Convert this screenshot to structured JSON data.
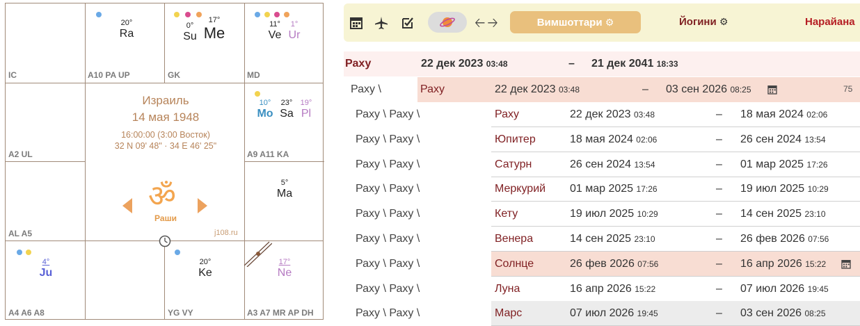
{
  "chart": {
    "center": {
      "place": "Израиль",
      "date": "14 мая 1948",
      "time": "16:00:00 (3:00 Восток)",
      "coords": "32 N 09' 48\" · 34 E 46' 25\"",
      "rashi_label": "Раши",
      "site": "j108.ru",
      "om_symbol": "ॐ"
    },
    "houses": {
      "ic": "IC",
      "a10": "A10 PA UP",
      "gk": "GK",
      "md": "MD",
      "a2": "A2 UL",
      "a9": "A9 A11 KA",
      "al": "AL A5",
      "a4": "A4 A6 A8",
      "yg": "YG VY",
      "a3": "A3 A7 MR AP DH"
    },
    "planets": {
      "ra": {
        "deg": "20°",
        "name": "Ra"
      },
      "su": {
        "deg": "0°",
        "name": "Su"
      },
      "me": {
        "deg": "17°",
        "name": "Me"
      },
      "ve": {
        "deg": "11°",
        "name": "Ve"
      },
      "ur": {
        "deg": "1°",
        "name": "Ur"
      },
      "mo": {
        "deg": "10°",
        "name": "Mo"
      },
      "sa": {
        "deg": "23°",
        "name": "Sa"
      },
      "pl": {
        "deg": "19°",
        "name": "Pl"
      },
      "ma": {
        "deg": "5°",
        "name": "Ma"
      },
      "ju": {
        "deg": "4°",
        "name": "Ju"
      },
      "ke": {
        "deg": "20°",
        "name": "Ke"
      },
      "ne": {
        "deg": "17°",
        "name": "Ne"
      }
    },
    "colors": {
      "blue_dot": "#6aa9e6",
      "yellow_dot": "#f2d34f",
      "pink_dot": "#d94c8f",
      "orange_dot": "#f0a35b",
      "mo": "#3a8fc1",
      "ur_pl_ne": "#b57ac2",
      "ju": "#5960d6",
      "accent": "#b7845a"
    }
  },
  "toolbar": {
    "icons": [
      "calendar-icon",
      "airplane-icon",
      "edit-check-icon",
      "planet-icon",
      "arrow-left-icon",
      "arrow-right-icon",
      "gear-icon"
    ],
    "vimshottari": "Вимшоттари",
    "yogini": "Йогини",
    "narayana": "Нарайана"
  },
  "dasha": {
    "maha": {
      "lord": "Раху",
      "start_date": "22 дек 2023",
      "start_time": "03:48",
      "dash": "–",
      "end_date": "21 дек 2041",
      "end_time": "18:33"
    },
    "antar": {
      "path": "Раху \\",
      "lord": "Раху",
      "start_date": "22 дек 2023",
      "start_time": "03:48",
      "dash": "–",
      "end_date": "03 сен 2026",
      "end_time": "08:25",
      "count": "75"
    },
    "pratyantar": [
      {
        "path": "Раху \\ Раху \\",
        "lord": "Раху",
        "start_date": "22 дек 2023",
        "start_time": "03:48",
        "dash": "–",
        "end_date": "18 мая 2024",
        "end_time": "02:06"
      },
      {
        "path": "Раху \\ Раху \\",
        "lord": "Юпитер",
        "start_date": "18 мая 2024",
        "start_time": "02:06",
        "dash": "–",
        "end_date": "26 сен 2024",
        "end_time": "13:54"
      },
      {
        "path": "Раху \\ Раху \\",
        "lord": "Сатурн",
        "start_date": "26 сен 2024",
        "start_time": "13:54",
        "dash": "–",
        "end_date": "01 мар 2025",
        "end_time": "17:26"
      },
      {
        "path": "Раху \\ Раху \\",
        "lord": "Меркурий",
        "start_date": "01 мар 2025",
        "start_time": "17:26",
        "dash": "–",
        "end_date": "19 июл 2025",
        "end_time": "10:29"
      },
      {
        "path": "Раху \\ Раху \\",
        "lord": "Кету",
        "start_date": "19 июл 2025",
        "start_time": "10:29",
        "dash": "–",
        "end_date": "14 сен 2025",
        "end_time": "23:10"
      },
      {
        "path": "Раху \\ Раху \\",
        "lord": "Венера",
        "start_date": "14 сен 2025",
        "start_time": "23:10",
        "dash": "–",
        "end_date": "26 фев 2026",
        "end_time": "07:56"
      },
      {
        "path": "Раху \\ Раху \\",
        "lord": "Солнце",
        "start_date": "26 фев 2026",
        "start_time": "07:56",
        "dash": "–",
        "end_date": "16 апр 2026",
        "end_time": "15:22"
      },
      {
        "path": "Раху \\ Раху \\",
        "lord": "Луна",
        "start_date": "16 апр 2026",
        "start_time": "15:22",
        "dash": "–",
        "end_date": "07 июл 2026",
        "end_time": "19:45"
      },
      {
        "path": "Раху \\ Раху \\",
        "lord": "Марс",
        "start_date": "07 июл 2026",
        "start_time": "19:45",
        "dash": "–",
        "end_date": "03 сен 2026",
        "end_time": "08:25"
      }
    ]
  }
}
